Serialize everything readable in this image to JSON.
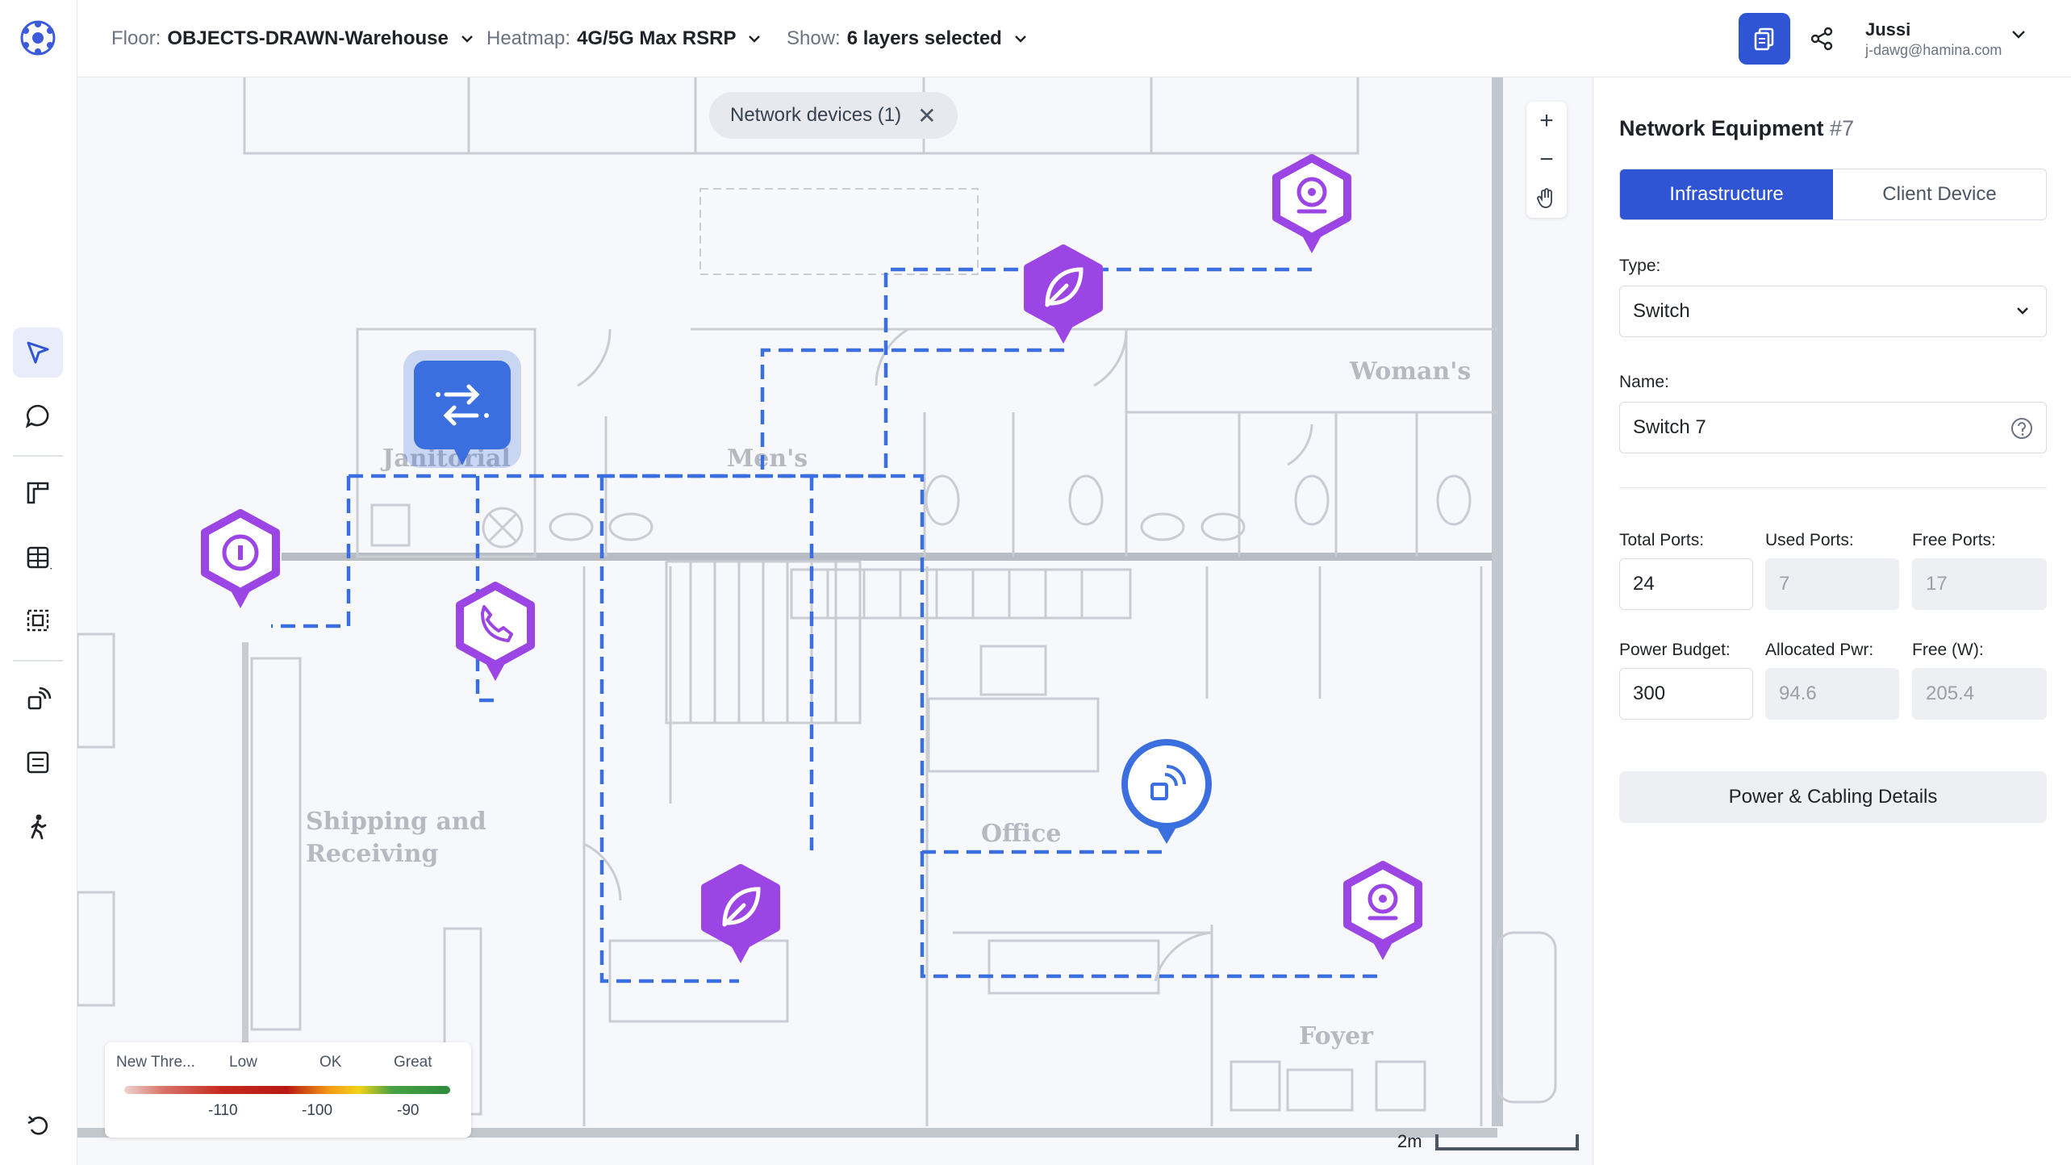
{
  "topbar": {
    "floor_label": "Floor:",
    "floor_value": "OBJECTS-DRAWN-Warehouse",
    "heatmap_label": "Heatmap:",
    "heatmap_value": "4G/5G Max RSRP",
    "show_label": "Show:",
    "show_value": "6 layers selected",
    "user_name": "Jussi",
    "user_email": "j-dawg@hamina.com"
  },
  "map": {
    "filter_chip": "Network devices (1)",
    "zoom_in": "+",
    "zoom_out": "−",
    "rooms": {
      "janitorial": "Janitorial",
      "mens": "Men's",
      "womans": "Woman's",
      "shipping_line1": "Shipping and",
      "shipping_line2": "Receiving",
      "office": "Office",
      "foyer": "Foyer"
    },
    "legend": {
      "categories": [
        "New Thre...",
        "Low",
        "OK",
        "Great"
      ],
      "ticks": [
        "-110",
        "-100",
        "-90"
      ],
      "colors": [
        "#c62a1f",
        "#f49b18",
        "#f2d21a",
        "#2e8b3a"
      ]
    },
    "scale_label": "2m",
    "device_color": "#9b45e4",
    "selected_color": "#3b6fe0",
    "cable_color": "#3b6fe0"
  },
  "panel": {
    "title": "Network Equipment",
    "title_num": "#7",
    "tab_infra": "Infrastructure",
    "tab_client": "Client Device",
    "type_label": "Type:",
    "type_value": "Switch",
    "name_label": "Name:",
    "name_value": "Switch 7",
    "total_ports_label": "Total Ports:",
    "total_ports": "24",
    "used_ports_label": "Used Ports:",
    "used_ports": "7",
    "free_ports_label": "Free Ports:",
    "free_ports": "17",
    "power_budget_label": "Power Budget:",
    "power_budget": "300",
    "allocated_label": "Allocated Pwr:",
    "allocated": "94.6",
    "free_w_label": "Free (W):",
    "free_w": "205.4",
    "details_button": "Power & Cabling Details"
  }
}
